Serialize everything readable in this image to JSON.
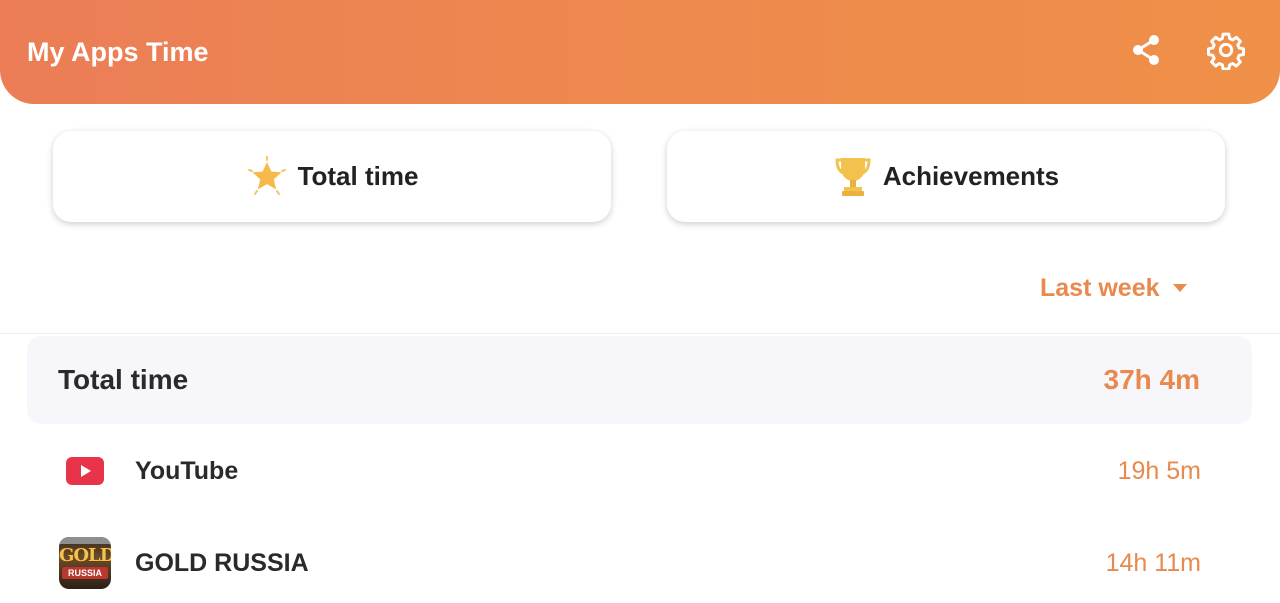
{
  "header": {
    "title": "My Apps Time",
    "share_icon": "share-icon",
    "settings_icon": "gear-icon"
  },
  "cards": {
    "total_time_label": "Total time",
    "total_time_icon": "star-icon",
    "achievements_label": "Achievements",
    "achievements_icon": "trophy-icon"
  },
  "filter": {
    "selected": "Last week",
    "icon": "caret-down-icon"
  },
  "summary": {
    "label": "Total time",
    "value": "37h 4m"
  },
  "apps": [
    {
      "name": "YouTube",
      "time": "19h 5m",
      "icon": "youtube-icon"
    },
    {
      "name": "GOLD RUSSIA",
      "time": "14h 11m",
      "icon": "gold-russia-app-icon",
      "icon_text_top": "GOLD",
      "icon_text_bottom": "RUSSIA"
    }
  ],
  "colors": {
    "accent": "#e8894d",
    "header_start": "#ec7d57",
    "header_end": "#ef9048",
    "star": "#f7b94b",
    "trophy": "#f2c14e",
    "youtube": "#e8344a"
  }
}
